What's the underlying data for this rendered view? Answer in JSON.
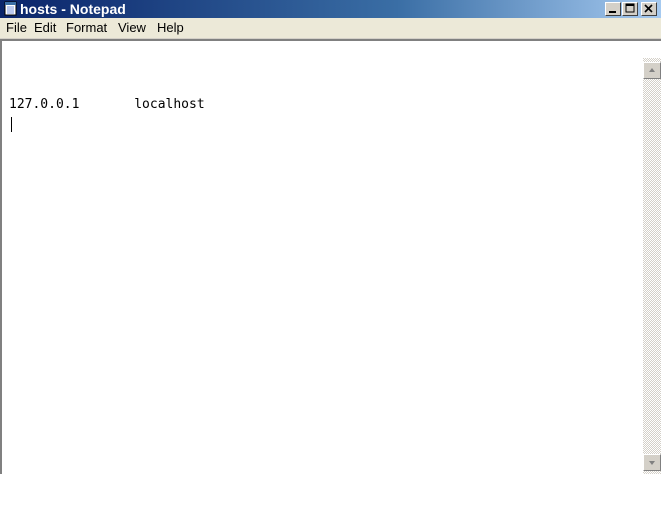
{
  "window": {
    "title": "hosts - Notepad"
  },
  "title_buttons": {
    "minimize_icon": "minimize-icon",
    "maximize_icon": "maximize-icon",
    "close_icon": "close-icon"
  },
  "menu": {
    "items": [
      {
        "label": "File"
      },
      {
        "label": "Edit"
      },
      {
        "label": "Format"
      },
      {
        "label": "View"
      },
      {
        "label": "Help"
      }
    ]
  },
  "editor": {
    "content": "127.0.0.1       localhost"
  },
  "colors": {
    "titlebar": "#0a246a",
    "title_text": "#ffffff",
    "chrome": "#d4d0c8",
    "editor_bg": "#ffffff"
  }
}
